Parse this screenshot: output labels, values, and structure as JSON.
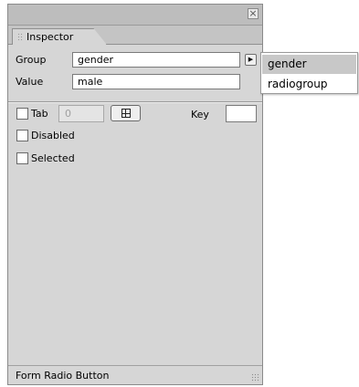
{
  "panel": {
    "close_glyph": "×",
    "tab_label": "Inspector",
    "group": {
      "label": "Group",
      "value": "gender"
    },
    "value": {
      "label": "Value",
      "value": "male"
    },
    "tab_index": {
      "label": "Tab",
      "value": "0"
    },
    "key": {
      "label": "Key",
      "value": ""
    },
    "disabled_label": "Disabled",
    "selected_label": "Selected",
    "status_text": "Form Radio Button",
    "popup_glyph": "▶"
  },
  "dropdown": {
    "options": [
      "gender",
      "radiogroup"
    ],
    "selected": "gender"
  }
}
